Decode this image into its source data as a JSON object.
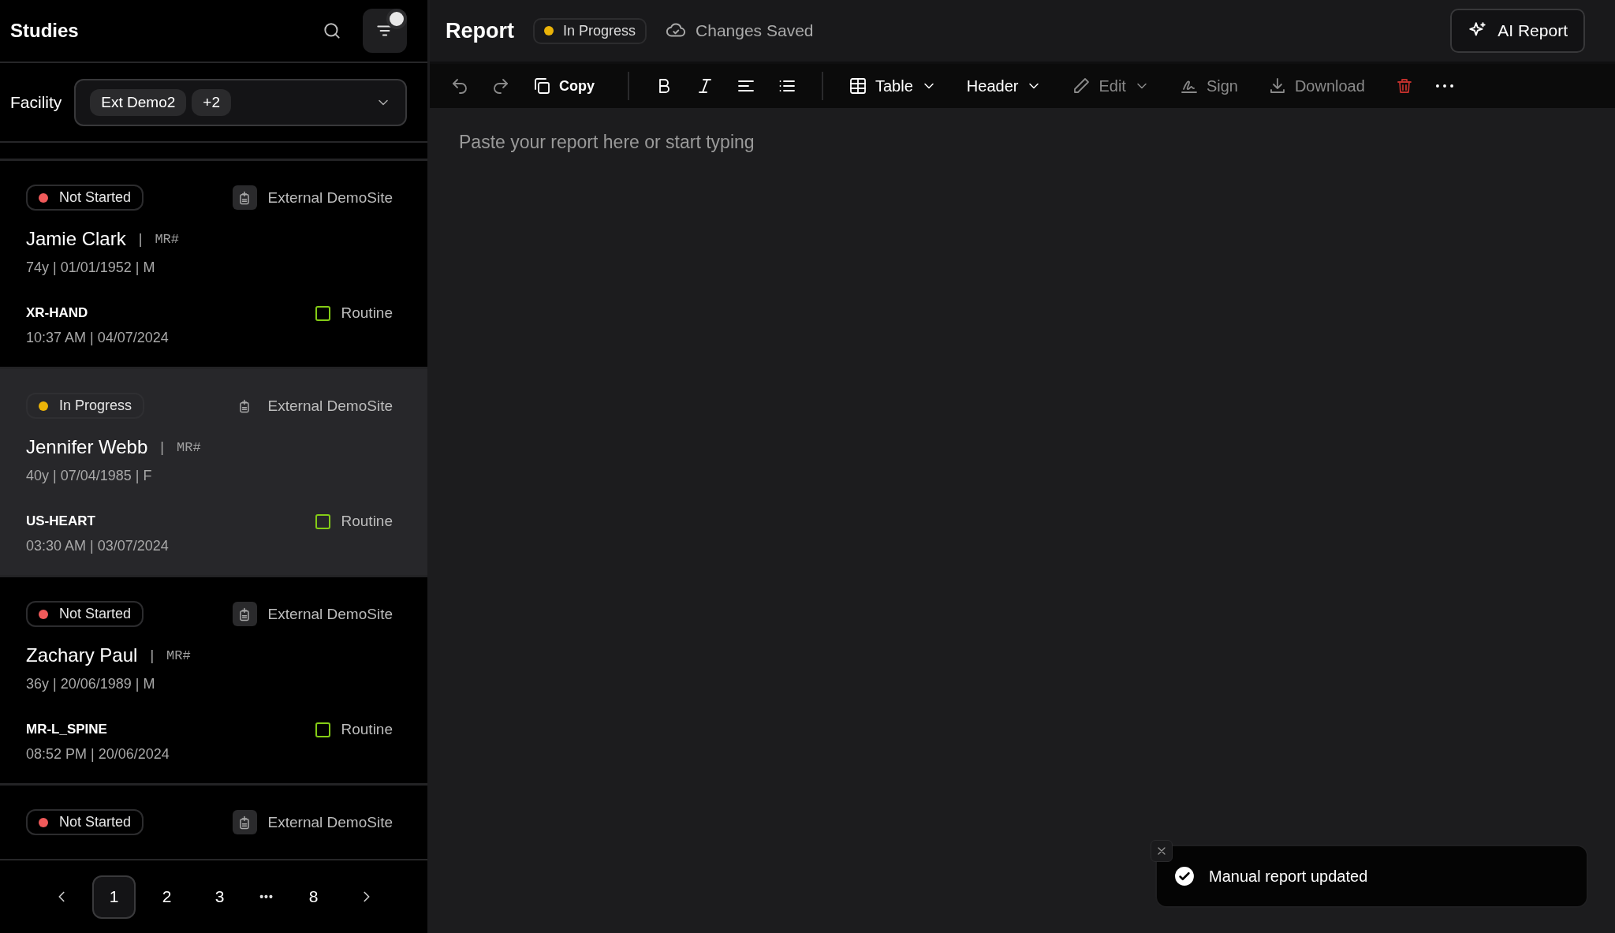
{
  "sidebar": {
    "title": "Studies",
    "filter": {
      "active": true
    },
    "facility": {
      "label": "Facility",
      "chips": [
        "Ext Demo2",
        "+2"
      ]
    },
    "studies": [
      {
        "status": {
          "label": "Not Started",
          "color": "#f05a5a"
        },
        "site": "External DemoSite",
        "name": "Jamie Clark",
        "separator": "|",
        "mr": "MR#",
        "demographics": "74y | 01/01/1952 | M",
        "procedure": "XR-HAND",
        "priority": "Routine",
        "time": "10:37 AM | 04/07/2024",
        "selected": false
      },
      {
        "status": {
          "label": "In Progress",
          "color": "#eab308"
        },
        "site": "External DemoSite",
        "name": "Jennifer Webb",
        "separator": "|",
        "mr": "MR#",
        "demographics": "40y | 07/04/1985 | F",
        "procedure": "US-HEART",
        "priority": "Routine",
        "time": "03:30 AM | 03/07/2024",
        "selected": true
      },
      {
        "status": {
          "label": "Not Started",
          "color": "#f05a5a"
        },
        "site": "External DemoSite",
        "name": "Zachary Paul",
        "separator": "|",
        "mr": "MR#",
        "demographics": "36y | 20/06/1989 | M",
        "procedure": "MR-L_SPINE",
        "priority": "Routine",
        "time": "08:52 PM | 20/06/2024",
        "selected": false
      },
      {
        "status": {
          "label": "Not Started",
          "color": "#f05a5a"
        },
        "site": "External DemoSite",
        "selected": false
      }
    ],
    "pagination": [
      {
        "kind": "prev"
      },
      {
        "kind": "page",
        "label": "1",
        "selected": true
      },
      {
        "kind": "page",
        "label": "2",
        "selected": false
      },
      {
        "kind": "page",
        "label": "3",
        "selected": false
      },
      {
        "kind": "ellipsis",
        "label": "•••"
      },
      {
        "kind": "page",
        "label": "8",
        "selected": false
      },
      {
        "kind": "next"
      }
    ]
  },
  "report": {
    "title": "Report",
    "status": {
      "label": "In Progress",
      "color": "#eab308"
    },
    "save_state": "Changes Saved",
    "ai_button": "AI Report",
    "toolbar": [
      {
        "kind": "undo",
        "disabled": true
      },
      {
        "kind": "redo",
        "disabled": true
      },
      {
        "kind": "copy",
        "label": "Copy",
        "disabled": false
      },
      {
        "kind": "divider"
      },
      {
        "kind": "bold",
        "disabled": false
      },
      {
        "kind": "italic",
        "disabled": false
      },
      {
        "kind": "align",
        "disabled": false
      },
      {
        "kind": "list",
        "disabled": false
      },
      {
        "kind": "divider"
      },
      {
        "kind": "table",
        "label": "Table",
        "disabled": false
      },
      {
        "kind": "header",
        "label": "Header",
        "disabled": false
      },
      {
        "kind": "edit",
        "label": "Edit",
        "disabled": true
      },
      {
        "kind": "sign",
        "label": "Sign",
        "disabled": true
      },
      {
        "kind": "download",
        "label": "Download",
        "disabled": true
      },
      {
        "kind": "delete",
        "disabled": false
      },
      {
        "kind": "more",
        "disabled": false
      }
    ],
    "placeholder": "Paste your report here or start typing"
  },
  "toast": {
    "message": "Manual report updated"
  }
}
